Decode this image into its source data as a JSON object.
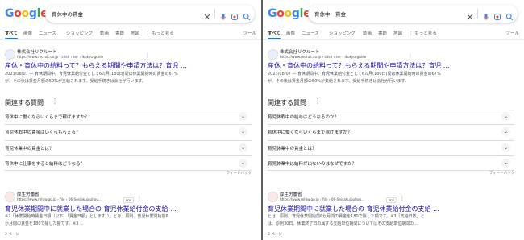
{
  "left": {
    "logo": [
      "G",
      "o",
      "o",
      "g",
      "l",
      "e"
    ],
    "query": "育休中の賃金",
    "tabs": [
      "すべて",
      "画像",
      "ニュース",
      "ショッピング",
      "動画",
      "書籍",
      "地図",
      "⋮ もっと見る"
    ],
    "tools": "ツール",
    "result1": {
      "site": "株式会社リクルート",
      "url": "https://www.recruit.co.jp › cdsh › ser › ikukyu-guide",
      "title": "産休・育休中の給料って？もらえる期間や申請方法は？育児 ...",
      "snippet1": "2023/08/07 — 育休期間中、育児休業給付金として6カ月(180日)間は休業開始時の賃金の67%",
      "snippet2": "が、その後は賃金月額の50%が支給されます。受給手続きは会社が行います。"
    },
    "paa": {
      "heading": "関連する質問",
      "questions": [
        "育休中に働くならいくらまで稼げますか？",
        "育児休暇中の賃金はいくらもらえる？",
        "育児休業中の賃金とは？",
        "育休中に仕事をすると給料はどうなる？"
      ]
    },
    "feedback": "フィードバック",
    "result2": {
      "site": "厚生労働省",
      "url": "https://www.mhlw.go.jp › file › 06-Seisakujouhou...",
      "pdf": "PDF",
      "title": "育児休業期間中に就業した場合の 育児休業給付金の支給 ...",
      "snippet1": "※2「休業開始時賃金日額（以下、「賃金日額」とします。）」とは、原則、育児休業開始前6",
      "snippet2": "か月間の賃金を180で除した額です。※3 ..."
    },
    "pages": "2 ページ"
  },
  "right": {
    "logo": [
      "G",
      "o",
      "o",
      "g",
      "l",
      "e"
    ],
    "query": "育休中　賃金",
    "tabs": [
      "すべて",
      "画像",
      "ニュース",
      "ショッピング",
      "動画",
      "書籍",
      "地図",
      "⋮ もっと見る"
    ],
    "tools": "ツール",
    "result1": {
      "site": "株式会社リクルート",
      "url": "https://www.recruit.co.jp › cdsh › ser › ikukyu-guide",
      "title": "産休・育休中の給料って？もらえる期間や申請方法は？育児 ...",
      "snippet1": "2023/08/07 — 育休期間中、育児休業給付金として6カ月(180日)間は休業開始時の賃金の67%",
      "snippet2": "が、その後は賃金月額の50%が支給されます。受給手続きは会社が行います。"
    },
    "paa": {
      "heading": "関連する質問",
      "questions": [
        "育児休暇中の給与はどうなるのか？",
        "育休中に働くならいくらまで稼げますか？",
        "育児休業中の賃金とは？",
        "育児休業中は給料が出ないのはなぜですか？"
      ]
    },
    "feedback": "フィードバック",
    "result2": {
      "site": "厚生労働省",
      "url": "https://www.mhlw.go.jp › file › 06-Seisakujouhou...",
      "pdf": "PDF",
      "title": "育児休業期間中に就業した場合の 育児休業給付金の支給 ...",
      "snippet1": "とは、原則、育児休業開始前6か月間の賃金を180で除した額です。※3「支給日数」と",
      "snippet2": "は、原則30日。休業終了日の属する支給単位期間についてはその支給単位期間の ..."
    },
    "pages": "2 ページ"
  },
  "colors": {
    "blue": "#4285f4",
    "red": "#ea4335",
    "yellow": "#fbbc05",
    "green": "#34a853",
    "link": "#1a0dab",
    "accent": "#1a73e8"
  },
  "icons": [
    "close-icon",
    "mic-icon",
    "lens-icon",
    "search-icon",
    "more-vert-icon",
    "chevron-down-icon"
  ]
}
